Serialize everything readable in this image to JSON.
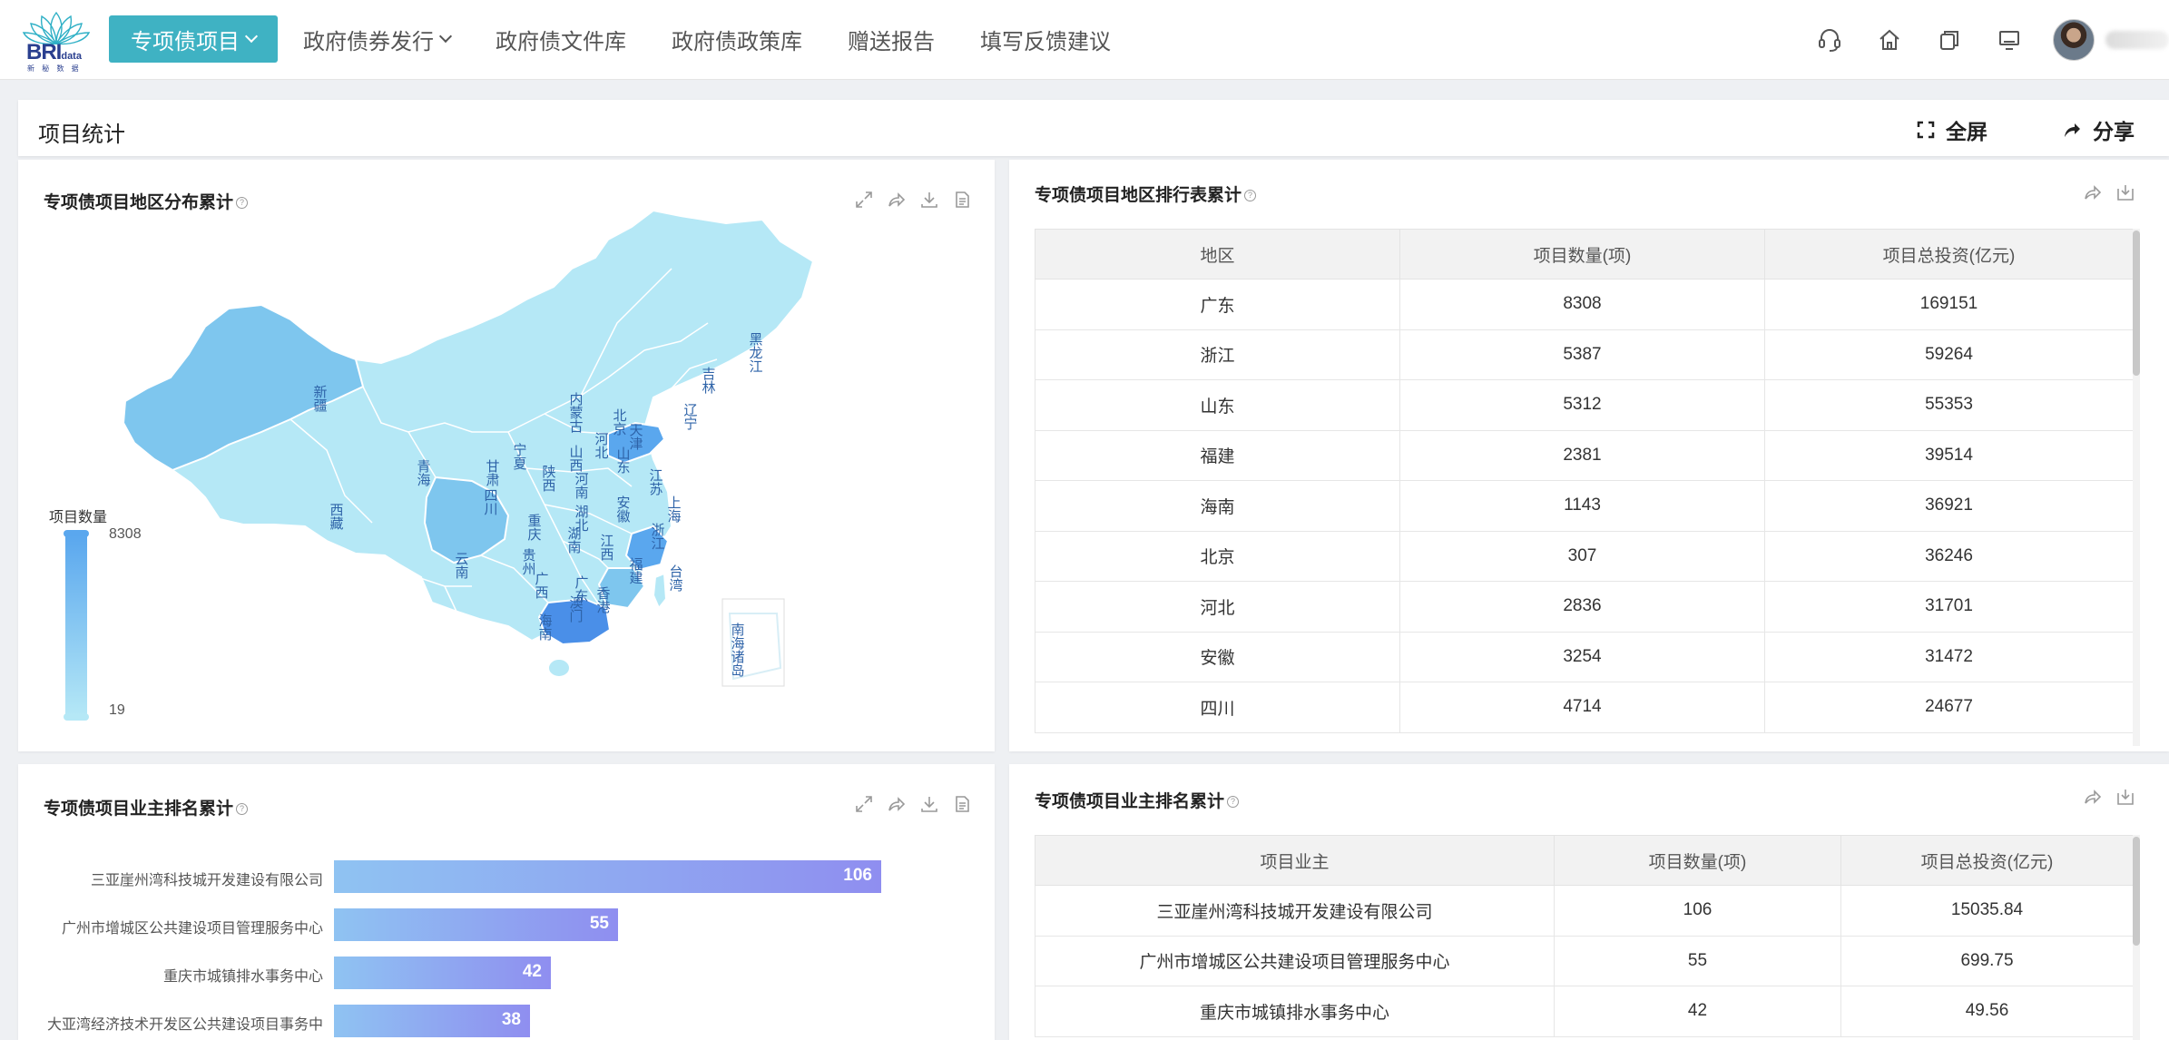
{
  "nav": {
    "logo_main": "BRI",
    "logo_small": "data",
    "logo_sub": "新 秘 数 据",
    "items": [
      {
        "label": "专项债项目"
      },
      {
        "label": "政府债券发行"
      },
      {
        "label": "政府债文件库"
      },
      {
        "label": "政府债政策库"
      },
      {
        "label": "赠送报告"
      },
      {
        "label": "填写反馈建议"
      }
    ]
  },
  "header": {
    "title": "项目统计",
    "fullscreen_label": "全屏",
    "share_label": "分享"
  },
  "map_panel": {
    "title": "专项债项目地区分布累计",
    "legend_title": "项目数量",
    "legend_max": "8308",
    "legend_min": "19",
    "colors": {
      "high": "#4a8fe8",
      "mid": "#7ec6ee",
      "low": "#b5e8f6"
    },
    "provinces": [
      {
        "name": "黑龙江"
      },
      {
        "name": "吉林"
      },
      {
        "name": "辽宁"
      },
      {
        "name": "内蒙古"
      },
      {
        "name": "新疆"
      },
      {
        "name": "北京"
      },
      {
        "name": "天津"
      },
      {
        "name": "河北"
      },
      {
        "name": "山西"
      },
      {
        "name": "山东"
      },
      {
        "name": "宁夏"
      },
      {
        "name": "甘肃"
      },
      {
        "name": "青海"
      },
      {
        "name": "陕西"
      },
      {
        "name": "河南"
      },
      {
        "name": "江苏"
      },
      {
        "name": "安徽"
      },
      {
        "name": "上海"
      },
      {
        "name": "西藏"
      },
      {
        "name": "四川"
      },
      {
        "name": "湖北"
      },
      {
        "name": "重庆"
      },
      {
        "name": "浙江"
      },
      {
        "name": "湖南"
      },
      {
        "name": "江西"
      },
      {
        "name": "贵州"
      },
      {
        "name": "福建"
      },
      {
        "name": "云南"
      },
      {
        "name": "台湾"
      },
      {
        "name": "广西"
      },
      {
        "name": "广东"
      },
      {
        "name": "澳门"
      },
      {
        "name": "香港"
      },
      {
        "name": "海南"
      },
      {
        "name": "南海诸岛"
      }
    ]
  },
  "rank_panel": {
    "title": "专项债项目地区排行表累计",
    "columns": [
      "地区",
      "项目数量(项)",
      "项目总投资(亿元)"
    ],
    "rows": [
      [
        "广东",
        "8308",
        "169151"
      ],
      [
        "浙江",
        "5387",
        "59264"
      ],
      [
        "山东",
        "5312",
        "55353"
      ],
      [
        "福建",
        "2381",
        "39514"
      ],
      [
        "海南",
        "1143",
        "36921"
      ],
      [
        "北京",
        "307",
        "36246"
      ],
      [
        "河北",
        "2836",
        "31701"
      ],
      [
        "安徽",
        "3254",
        "31472"
      ],
      [
        "四川",
        "4714",
        "24677"
      ]
    ]
  },
  "bar_panel": {
    "title": "专项债项目业主排名累计"
  },
  "owner_panel": {
    "title": "专项债项目业主排名累计",
    "columns": [
      "项目业主",
      "项目数量(项)",
      "项目总投资(亿元)"
    ],
    "rows": [
      [
        "三亚崖州湾科技城开发建设有限公司",
        "106",
        "15035.84"
      ],
      [
        "广州市增城区公共建设项目管理服务中心",
        "55",
        "699.75"
      ],
      [
        "重庆市城镇排水事务中心",
        "42",
        "49.56"
      ]
    ]
  },
  "chart_data": {
    "type": "bar",
    "orientation": "horizontal",
    "categories": [
      "三亚崖州湾科技城开发建设有限公司",
      "广州市增城区公共建设项目管理服务中心",
      "重庆市城镇排水事务中心",
      "大亚湾经济技术开发区公共建设项目事务中"
    ],
    "values": [
      106,
      55,
      42,
      38
    ],
    "xlim": [
      0,
      110
    ],
    "color": "#8fa8f0"
  }
}
